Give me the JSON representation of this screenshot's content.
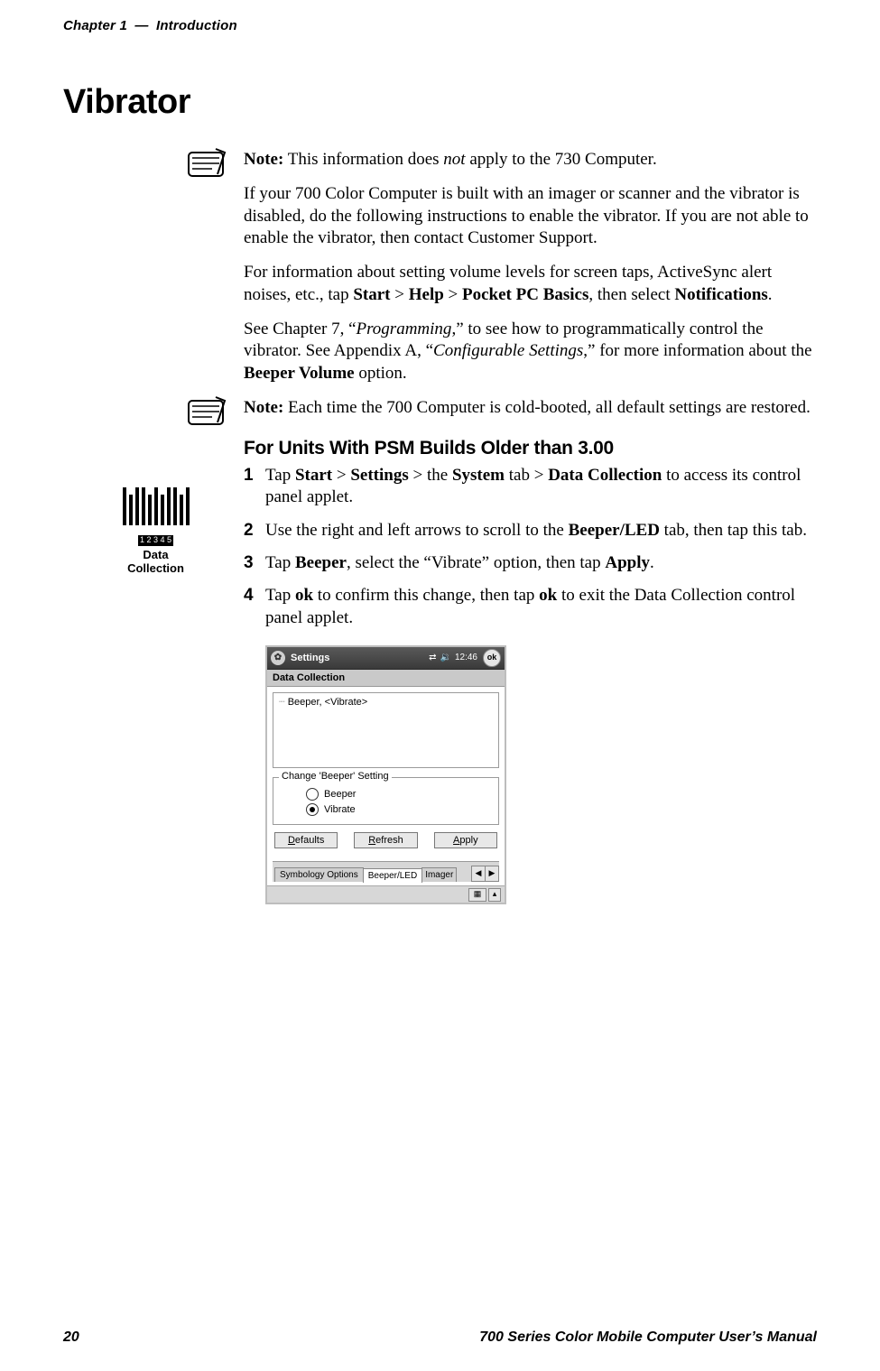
{
  "header": {
    "chapter": "Chapter 1",
    "dash": "—",
    "title": "Introduction"
  },
  "section_title": "Vibrator",
  "note1": {
    "prefix": "Note:",
    "before_em": " This information does ",
    "em": "not",
    "after_em": " apply to the 730 Computer."
  },
  "para1": "If your 700 Color Computer is built with an imager or scanner and the vibrator is disabled, do the following instructions to enable the vibrator. If you are not able to enable the vibrator, then contact Customer Support.",
  "para2": {
    "pre": "For information about setting volume levels for screen taps, ActiveSync alert noises, etc., tap ",
    "b1": "Start",
    "gt1": " > ",
    "b2": "Help",
    "gt2": " > ",
    "b3": "Pocket PC Basics",
    "mid": ", then select ",
    "b4": "Notifications",
    "end": "."
  },
  "para3": {
    "a": "See Chapter 7, “",
    "i1": "Programming",
    "b": ",” to see how to programmatically control the vibrator. See Appendix A, “",
    "i2": "Configurable Settings",
    "c": ",” for more information about the ",
    "bold": "Beeper Volume",
    "d": " option."
  },
  "note2": {
    "prefix": "Note:",
    "text": " Each time the 700 Computer is cold-booted, all default settings are restored."
  },
  "subhead": "For Units With PSM Builds Older than 3.00",
  "barcode": {
    "nums": "1 2 3 4 5",
    "line1": "Data",
    "line2": "Collection"
  },
  "steps": [
    {
      "num": "1",
      "parts": {
        "a": "Tap ",
        "b1": "Start",
        "g1": " > ",
        "b2": "Settings",
        "g2": " > the ",
        "b3": "System",
        "g3": " tab > ",
        "b4": "Data Collection",
        "end": " to access its control panel applet."
      }
    },
    {
      "num": "2",
      "parts": {
        "a": "Use the right and left arrows to scroll to the ",
        "b1": "Beeper/LED",
        "end": " tab, then tap this tab."
      }
    },
    {
      "num": "3",
      "parts": {
        "a": "Tap ",
        "b1": "Beeper",
        "mid": ", select the “Vibrate” option, then tap ",
        "b2": "Apply",
        "end": "."
      }
    },
    {
      "num": "4",
      "parts": {
        "a": "Tap ",
        "b1": "ok",
        "mid": " to confirm this change, then tap ",
        "b2": "ok",
        "end": " to exit the Data Collection control panel applet."
      }
    }
  ],
  "ppc": {
    "title": "Settings",
    "clock": "12:46",
    "ok": "ok",
    "subtitle": "Data Collection",
    "tree_item": "Beeper, <Vibrate>",
    "group_legend": "Change 'Beeper' Setting",
    "radio_beeper": "Beeper",
    "radio_vibrate": "Vibrate",
    "btn_defaults": "Defaults",
    "btn_refresh": "Refresh",
    "btn_apply": "Apply",
    "tab1": "Symbology Options",
    "tab2": "Beeper/LED",
    "tab3": "Imager",
    "arrow_left": "◀",
    "arrow_right": "▶",
    "sip": "▦",
    "sip_up": "▴"
  },
  "footer": {
    "page": "20",
    "title": "700 Series Color Mobile Computer User’s Manual"
  }
}
